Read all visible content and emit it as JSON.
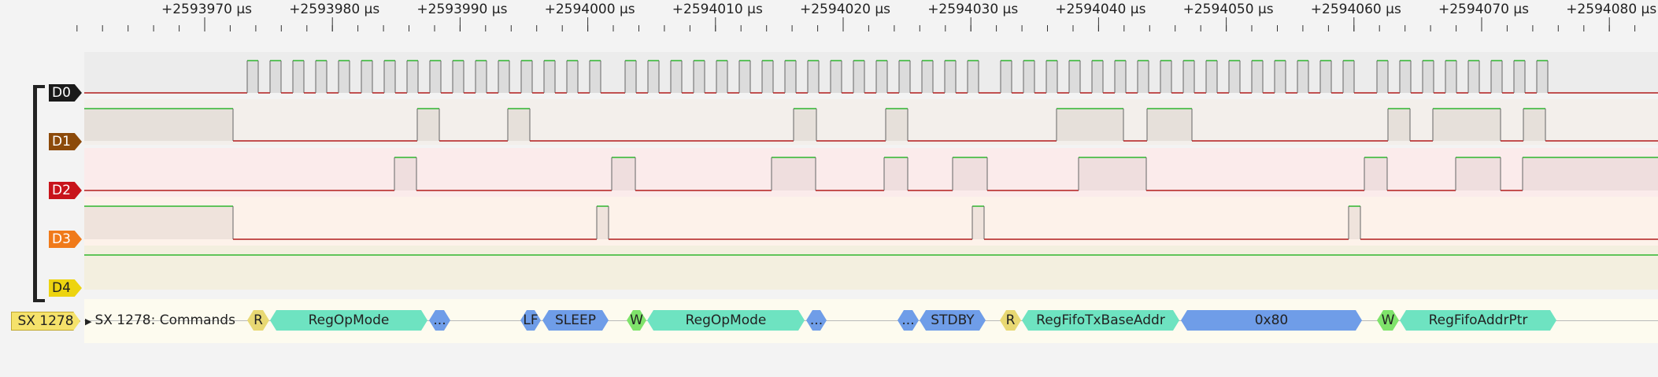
{
  "ruler": {
    "labels": [
      "+2593970 µs",
      "+2593980 µs",
      "+2593990 µs",
      "+2594000 µs",
      "+2594010 µs",
      "+2594020 µs",
      "+2594030 µs",
      "+2594040 µs",
      "+2594050 µs",
      "+2594060 µs",
      "+2594070 µs",
      "+2594080 µs"
    ]
  },
  "channels": [
    {
      "name": "D0",
      "color": "#1a1a1a",
      "text": "light"
    },
    {
      "name": "D1",
      "color": "#8c4a0a",
      "text": "light"
    },
    {
      "name": "D2",
      "color": "#c8141b",
      "text": "light"
    },
    {
      "name": "D3",
      "color": "#f07a1a",
      "text": "light"
    },
    {
      "name": "D4",
      "color": "#edd410",
      "text": "dark"
    }
  ],
  "decoder": {
    "label": "SX 1278",
    "row_name": "SX 1278: Commands",
    "annotations": [
      {
        "text": "R",
        "color": "#e8d873"
      },
      {
        "text": "RegOpMode",
        "color": "#6ee3c1"
      },
      {
        "text": "...",
        "color": "#6f9de8"
      },
      {
        "text": "LF",
        "color": "#6f9de8"
      },
      {
        "text": "SLEEP",
        "color": "#6f9de8"
      },
      {
        "text": "W",
        "color": "#7fe36b"
      },
      {
        "text": "RegOpMode",
        "color": "#6ee3c1"
      },
      {
        "text": "...",
        "color": "#6f9de8"
      },
      {
        "text": "...",
        "color": "#6f9de8"
      },
      {
        "text": "STDBY",
        "color": "#6f9de8"
      },
      {
        "text": "R",
        "color": "#e8d873"
      },
      {
        "text": "RegFifoTxBaseAddr",
        "color": "#6ee3c1"
      },
      {
        "text": "0x80",
        "color": "#6f9de8"
      },
      {
        "text": "W",
        "color": "#7fe36b"
      },
      {
        "text": "RegFifoAddrPtr",
        "color": "#6ee3c1"
      }
    ]
  },
  "colors": {
    "wave_high": "#2fb62f",
    "wave_low": "#b21c1c"
  }
}
